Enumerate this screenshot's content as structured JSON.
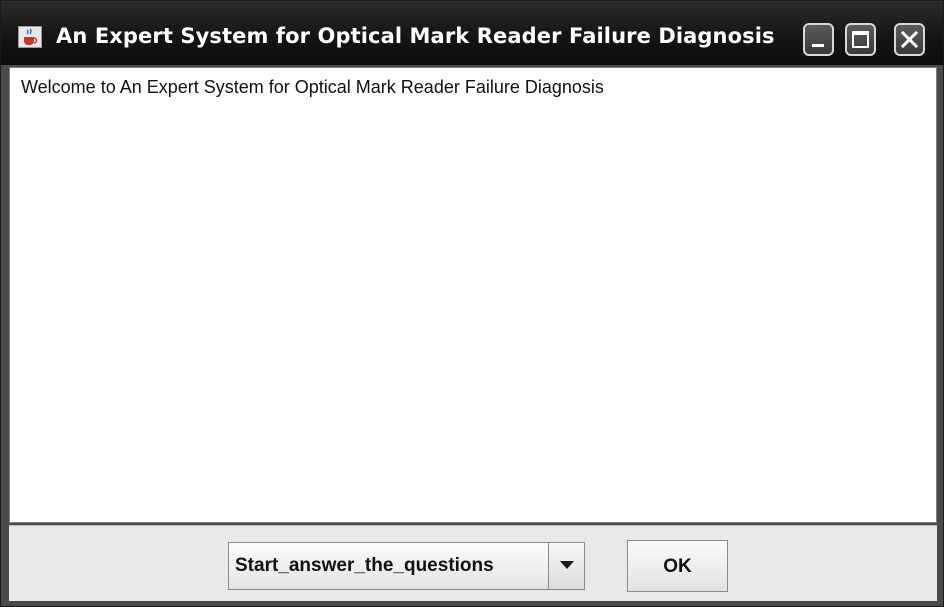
{
  "window": {
    "title": "An Expert System for Optical Mark Reader Failure Diagnosis",
    "icon": "java-cup-icon",
    "controls": [
      "minimize-icon",
      "maximize-icon",
      "close-icon"
    ]
  },
  "main": {
    "welcome_text": "Welcome to An Expert System for Optical Mark Reader Failure Diagnosis"
  },
  "footer": {
    "combo_selected": "Start_answer_the_questions",
    "ok_label": "OK"
  },
  "colors": {
    "titlebar": "#151515",
    "content_bg": "#ffffff",
    "footer_bg": "#e8e8e8"
  }
}
